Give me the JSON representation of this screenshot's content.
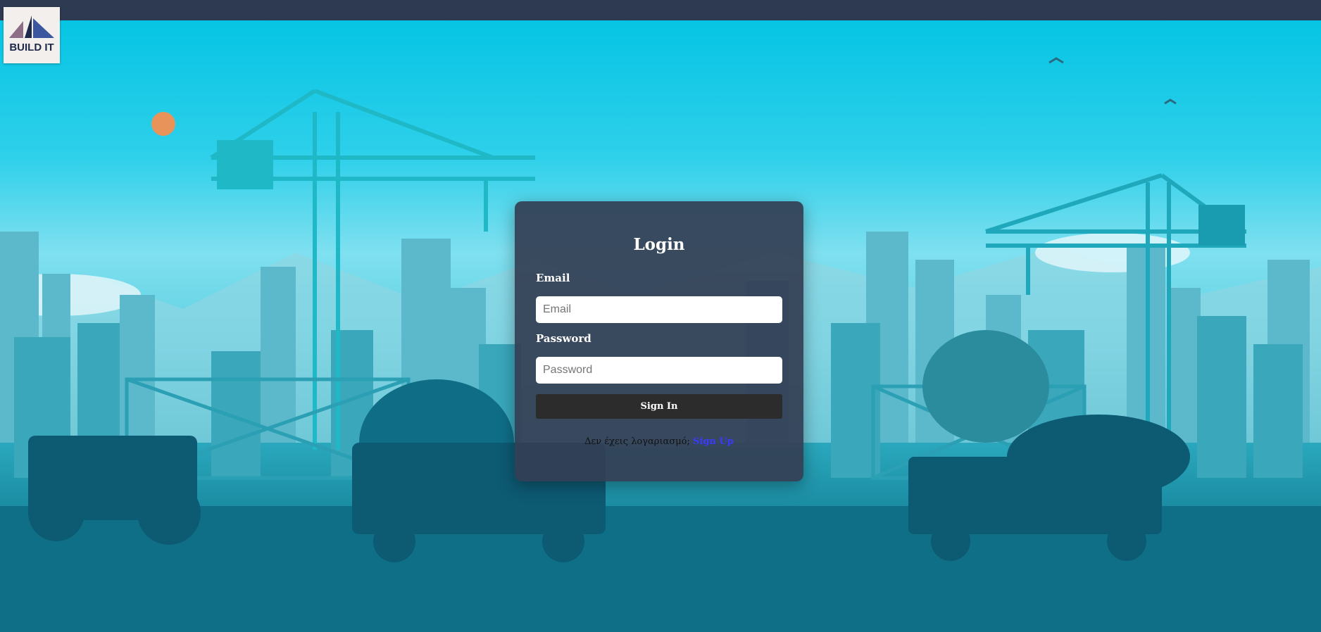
{
  "logo": {
    "text": "BUILD IT"
  },
  "login": {
    "title": "Login",
    "email_label": "Email",
    "email_placeholder": "Email",
    "password_label": "Password",
    "password_placeholder": "Password",
    "signin_label": "Sign In",
    "no_account_text": "Δεν έχεις λογαριασμό;",
    "signup_label": "Sign Up"
  },
  "colors": {
    "topbar": "#2e3a52",
    "card": "#343e54",
    "button": "#2c2c2c",
    "link": "#3a3aff"
  }
}
